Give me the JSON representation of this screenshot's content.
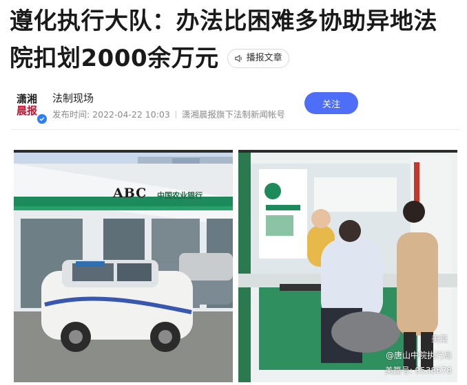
{
  "article": {
    "title_line1": "遵化执行大队：办法比困难多协助异地法",
    "title_line2": "院扣划2000余万元",
    "speak_label": "播报文章"
  },
  "author": {
    "avatar_top": "潇湘",
    "avatar_bottom": "晨报",
    "name": "法制现场",
    "publish_time": "发布时间: 2022-04-22 10:03",
    "source": "潇湘晨报旗下法制新闻帐号",
    "follow_label": "关注"
  },
  "photos": {
    "left": {
      "bank_sign": "ABC",
      "bank_name": "中国农业银行"
    },
    "right": {
      "watermark_brand": "美篇",
      "watermark_account": "@唐山中院执行局",
      "watermark_id": "美篇号: 9538678"
    }
  },
  "colors": {
    "follow": "#4f6ef7",
    "bank_green": "#1d6b48"
  }
}
